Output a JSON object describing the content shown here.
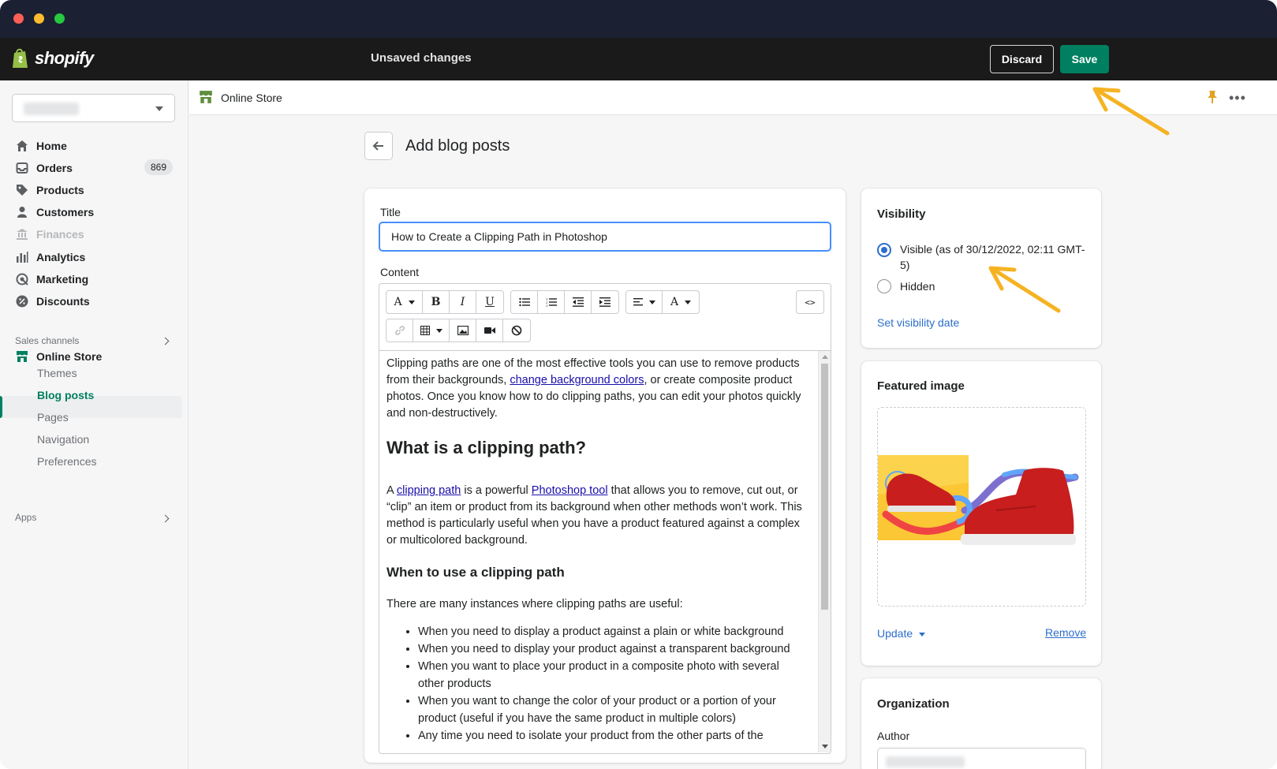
{
  "window": {
    "traffic_lights": [
      "close",
      "minimize",
      "maximize"
    ]
  },
  "topbar": {
    "logo_text": "shopify",
    "status": "Unsaved changes",
    "discard_label": "Discard",
    "save_label": "Save"
  },
  "sidebar": {
    "items": [
      {
        "label": "Home",
        "icon": "home-icon"
      },
      {
        "label": "Orders",
        "icon": "orders-icon",
        "badge": "869"
      },
      {
        "label": "Products",
        "icon": "tag-icon"
      },
      {
        "label": "Customers",
        "icon": "person-icon"
      },
      {
        "label": "Finances",
        "icon": "bank-icon",
        "disabled": true
      },
      {
        "label": "Analytics",
        "icon": "bar-chart-icon"
      },
      {
        "label": "Marketing",
        "icon": "target-icon"
      },
      {
        "label": "Discounts",
        "icon": "discount-icon"
      }
    ],
    "sales_channels_label": "Sales channels",
    "online_store_label": "Online Store",
    "sub_items": [
      "Themes",
      "Blog posts",
      "Pages",
      "Navigation",
      "Preferences"
    ],
    "active_sub_item": "Blog posts",
    "apps_label": "Apps"
  },
  "breadcrumb": {
    "label": "Online Store"
  },
  "page": {
    "title": "Add blog posts"
  },
  "editor": {
    "title_label": "Title",
    "title_value": "How to Create a Clipping Path in Photoshop",
    "content_label": "Content",
    "code_label": "<>",
    "body": {
      "p1_a": "Clipping paths are one of the most effective tools you can use to remove products from their backgrounds, ",
      "p1_link": "change background colors",
      "p1_b": ", or create composite product photos. Once you know how to do clipping paths, you can edit your photos quickly and non-destructively.",
      "h2": "What is a clipping path?",
      "p2_a": "A ",
      "p2_link1": "clipping path",
      "p2_b": " is a powerful ",
      "p2_link2": "Photoshop tool",
      "p2_c": " that allows you to remove, cut out, or “clip” an item or product from its background when other methods won’t work. This method is particularly useful when you have a product featured against a complex or multicolored background.",
      "h3": "When to use a clipping path",
      "p3": "There are many instances where clipping paths are useful:",
      "list": [
        "When you need to display a product against a plain or white background",
        "When you need to display your product against a transparent background",
        "When you want to place your product in a composite photo with several other products",
        "When you want to change the color of your product or a portion of your product (useful if you have the same product in multiple colors)",
        "Any time you need to isolate your product from the other parts of the"
      ]
    }
  },
  "visibility": {
    "title": "Visibility",
    "visible_label": "Visible (as of 30/12/2022, 02:11 GMT-5)",
    "hidden_label": "Hidden",
    "selected": "Visible",
    "set_date_link": "Set visibility date"
  },
  "featured_image": {
    "title": "Featured image",
    "update_label": "Update",
    "remove_label": "Remove"
  },
  "organization": {
    "title": "Organization",
    "author_label": "Author"
  },
  "colors": {
    "accent_green": "#008060",
    "link_blue": "#2c6ecb",
    "annotation_arrow": "#f5b323"
  }
}
